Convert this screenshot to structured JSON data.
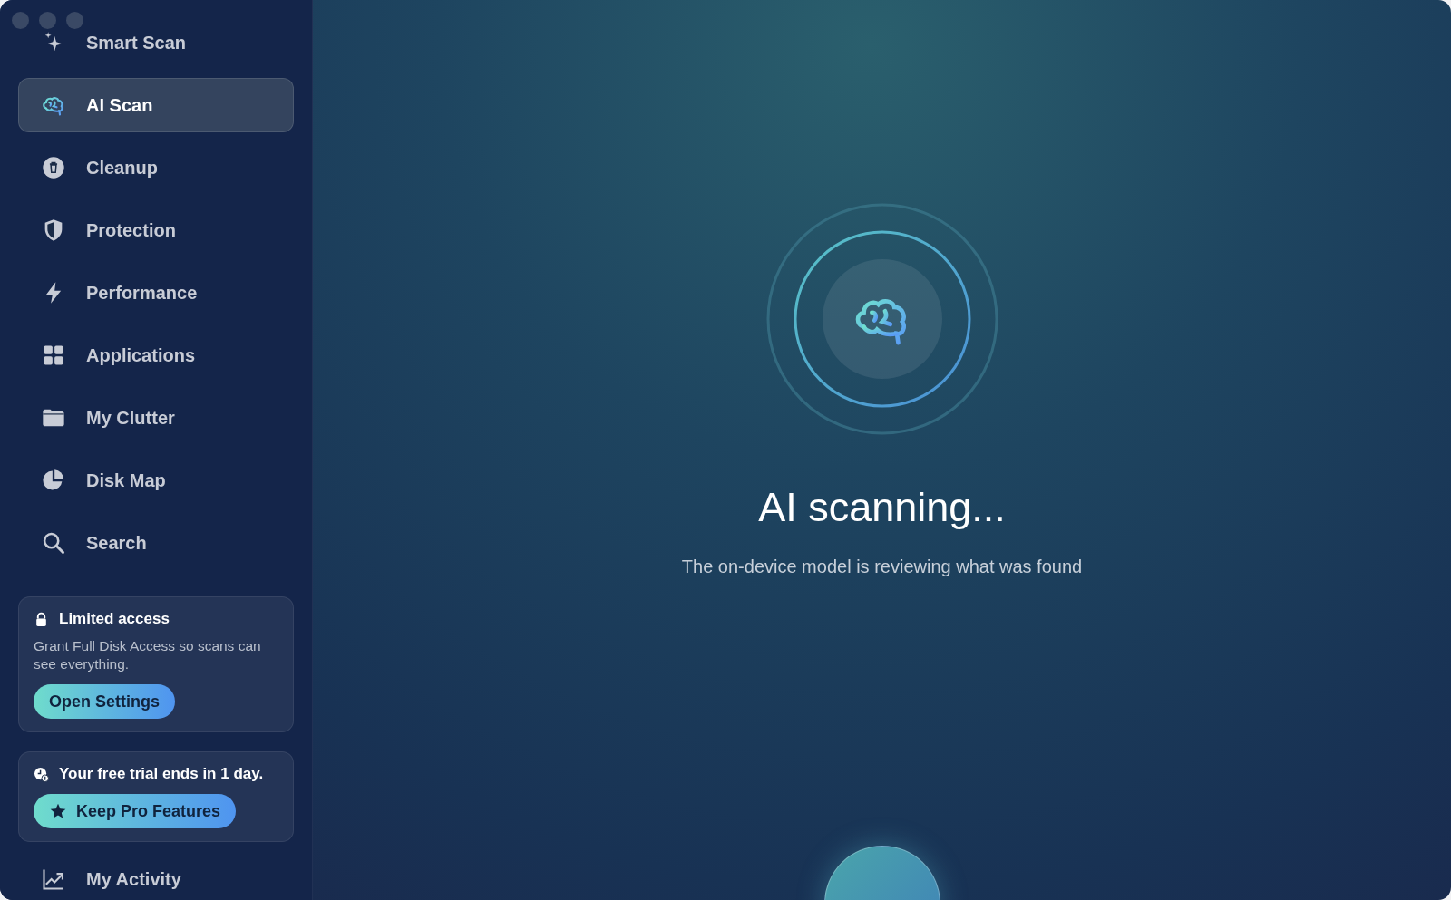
{
  "sidebar": {
    "items": [
      {
        "label": "Smart Scan",
        "selected": false
      },
      {
        "label": "AI Scan",
        "selected": true
      },
      {
        "label": "Cleanup",
        "selected": false
      },
      {
        "label": "Protection",
        "selected": false
      },
      {
        "label": "Performance",
        "selected": false
      },
      {
        "label": "Applications",
        "selected": false
      },
      {
        "label": "My Clutter",
        "selected": false
      },
      {
        "label": "Disk Map",
        "selected": false
      },
      {
        "label": "Search",
        "selected": false
      }
    ],
    "access_card": {
      "title": "Limited access",
      "text": "Grant Full Disk Access so scans can see everything.",
      "button": "Open Settings"
    },
    "trial_card": {
      "text": "Your free trial ends in 1 day.",
      "button": "Keep Pro Features"
    },
    "footer_item": {
      "label": "My Activity",
      "selected": false
    }
  },
  "main": {
    "title": "AI scanning...",
    "subtitle": "The on-device model is reviewing what was found"
  }
}
